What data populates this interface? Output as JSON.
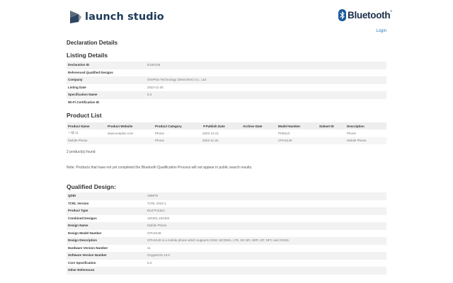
{
  "header": {
    "logo_text": "launch studio",
    "bluetooth_text": "Bluetooth",
    "bluetooth_reg": "®",
    "login_label": "Login"
  },
  "page": {
    "title": "Declaration Details"
  },
  "listing": {
    "heading": "Listing Details",
    "rows": [
      {
        "label": "Declaration ID",
        "value": "D160136"
      },
      {
        "label": "Referenced Qualified Designs",
        "value": ""
      },
      {
        "label": "Company",
        "value": "OnePlus Technology (Shenzhen) Co., Ltd."
      },
      {
        "label": "Listing Date",
        "value": "2022-11-25"
      },
      {
        "label": "Specification Name",
        "value": "5.3"
      },
      {
        "label": "Wi-Fi Certification ID",
        "value": ""
      }
    ]
  },
  "product_list": {
    "heading": "Product List",
    "columns": [
      "Product Name",
      "Product Website",
      "Product Category",
      "▼Publish Date",
      "Archive Date",
      "Model Number",
      "Subset ID",
      "Description"
    ],
    "rows": [
      [
        "一加 11",
        "www.oneplus.com",
        "Phone",
        "2022-12-21",
        "",
        "PHB110",
        "",
        "Phone"
      ],
      [
        "Mobile Phone",
        "",
        "Phone",
        "2022-11-25",
        "",
        "CPH2449",
        "",
        "Mobile Phone"
      ]
    ],
    "count_text": "2 product(s) found",
    "note": "Note: Products that have not yet completed the Bluetooth Qualification Process will not appear in public search results."
  },
  "qualified_design": {
    "heading": "Qualified Design:",
    "rows": [
      {
        "label": "QDID",
        "value": "198679"
      },
      {
        "label": "TCRL Version",
        "value": "TCRL 2022-1"
      },
      {
        "label": "Product Type",
        "value": "End Product"
      },
      {
        "label": "Combined Designs",
        "value": "150301,184483"
      },
      {
        "label": "Design Name",
        "value": "Mobile Phone"
      },
      {
        "label": "Design Model Number",
        "value": "CPH2449"
      },
      {
        "label": "Design Description",
        "value": "CPH2449 is a mobile phone which supports GSM, WCDMA, LTE, 5G NR, WIFI, BT, NFC and GNSS."
      },
      {
        "label": "Hardware Version Number",
        "value": "11"
      },
      {
        "label": "Software Version Number",
        "value": "OxygenOS 13.0"
      },
      {
        "label": "Core Specification",
        "value": "5.3"
      },
      {
        "label": "Other References",
        "value": ""
      }
    ]
  }
}
